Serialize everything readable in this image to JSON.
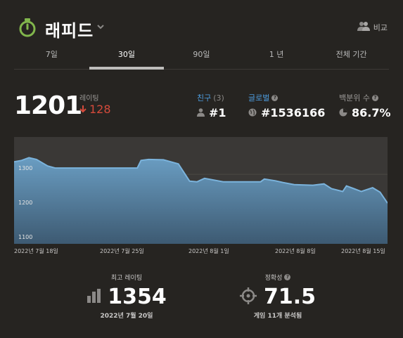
{
  "header": {
    "title": "래피드",
    "compare_label": "비교",
    "icons": {
      "mode": "stopwatch-icon",
      "dropdown": "chevron-down-icon",
      "compare": "people-icon"
    },
    "accent_color": "#81b64c"
  },
  "tabs": [
    {
      "label": "7일",
      "active": false
    },
    {
      "label": "30일",
      "active": true
    },
    {
      "label": "90일",
      "active": false
    },
    {
      "label": "1 년",
      "active": false
    },
    {
      "label": "전체 기간",
      "active": false
    }
  ],
  "rating": {
    "value": "1201",
    "label": "레이팅",
    "change": "128",
    "change_direction": "down",
    "change_color": "#d44a3b"
  },
  "stats": {
    "friends": {
      "label": "친구",
      "count": "(3)",
      "value": "#1",
      "label_color": "#4d9de0"
    },
    "global": {
      "label": "글로벌",
      "value": "#1536166",
      "label_color": "#4d9de0"
    },
    "percentile": {
      "label": "백분위 수",
      "value": "86.7%"
    }
  },
  "chart_data": {
    "type": "area",
    "x_tick_labels": [
      "2022년 7월 18일",
      "2022년 7월 25일",
      "2022년 8월 1일",
      "2022년 8월 8일",
      "2022년 8월 15일"
    ],
    "y_tick_labels": [
      "1300",
      "1200",
      "1100"
    ],
    "ylim": [
      1080,
      1390
    ],
    "grid": true,
    "fill_color": "#5d8fb3",
    "line_color": "#7bb3dc",
    "x": [
      0,
      2,
      4,
      6,
      9,
      11,
      16,
      20,
      33,
      34,
      36,
      40,
      44,
      47,
      49,
      51,
      56,
      59,
      66,
      67,
      70,
      72,
      75,
      80,
      83,
      85,
      88,
      89,
      91,
      93,
      96,
      98,
      100
    ],
    "y": [
      1318,
      1322,
      1330,
      1325,
      1306,
      1300,
      1300,
      1300,
      1300,
      1322,
      1325,
      1324,
      1312,
      1262,
      1260,
      1270,
      1260,
      1260,
      1260,
      1268,
      1263,
      1258,
      1252,
      1250,
      1254,
      1240,
      1232,
      1248,
      1240,
      1232,
      1243,
      1230,
      1198
    ]
  },
  "best_rating": {
    "label": "최고 레이팅",
    "value": "1354",
    "date": "2022년 7월 20일"
  },
  "accuracy": {
    "label": "정확성",
    "value": "71.5",
    "sub": "게임 11개 분석됨"
  }
}
